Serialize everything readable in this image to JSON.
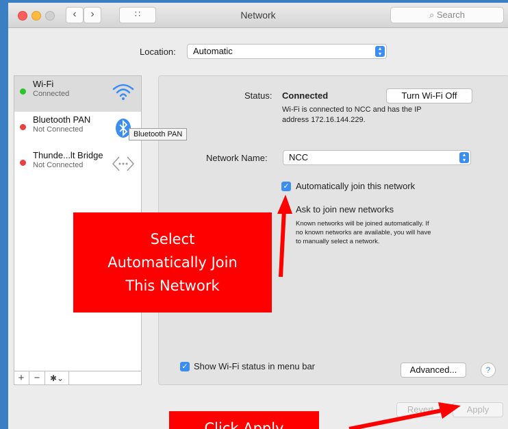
{
  "window": {
    "title": "Network",
    "search_placeholder": "Search",
    "grid_glyph": "∷"
  },
  "location": {
    "label": "Location:",
    "value": "Automatic"
  },
  "services": [
    {
      "name": "Wi-Fi",
      "status": "Connected",
      "status_color": "#2cc52c",
      "icon": "wifi-icon",
      "selected": true
    },
    {
      "name": "Bluetooth PAN",
      "status": "Not Connected",
      "status_color": "#e8413f",
      "icon": "bluetooth-icon",
      "selected": false
    },
    {
      "name": "Thunde...lt Bridge",
      "status": "Not Connected",
      "status_color": "#e8413f",
      "icon": "thunderbolt-bridge-icon",
      "selected": false
    }
  ],
  "tooltip": "Bluetooth PAN",
  "sidebar_buttons": {
    "add": "+",
    "remove": "−",
    "action": "✱⌄"
  },
  "detail": {
    "status_label": "Status:",
    "status_value": "Connected",
    "turn_off_button": "Turn Wi-Fi Off",
    "status_desc_line1": "Wi-Fi is connected to NCC and has the IP",
    "status_desc_line2": "address 172.16.144.229.",
    "network_name_label": "Network Name:",
    "network_name_value": "NCC",
    "auto_join_label": "Automatically join this network",
    "auto_join_checked": true,
    "ask_join_label": "Ask to join new networks",
    "ask_desc_line1": "Known networks will be joined automatically. If",
    "ask_desc_line2": "no known networks are available, you will have",
    "ask_desc_line3": "to manually select a network.",
    "show_status_label": "Show Wi-Fi status in menu bar",
    "show_status_checked": true,
    "advanced_button": "Advanced...",
    "help": "?"
  },
  "footer": {
    "revert_button": "Revert",
    "apply_button": "Apply"
  },
  "annotations": {
    "select_line1": "Select",
    "select_line2": "Automatically Join",
    "select_line3": "This Network",
    "apply_text": "Click Apply"
  },
  "colors": {
    "accent": "#3b8df2",
    "annotation_red": "#ff0000",
    "background": "#3a7fc4"
  }
}
